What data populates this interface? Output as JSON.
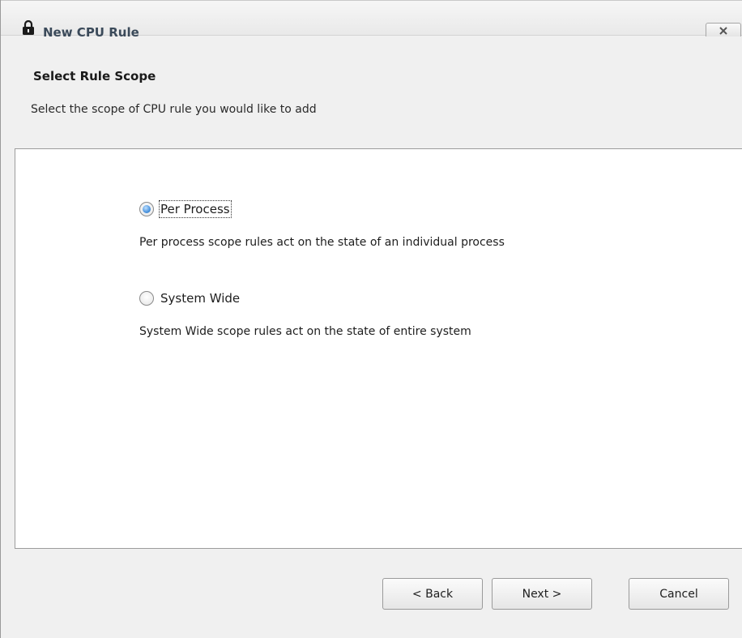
{
  "window": {
    "title": "New CPU Rule",
    "icon": "lock-icon",
    "close_symbol": "✕"
  },
  "header": {
    "title": "Select Rule Scope",
    "subtitle": "Select the scope of CPU rule you would like to add"
  },
  "options": [
    {
      "label": "Per Process",
      "description": "Per process scope rules act on the state of an individual process",
      "selected": true
    },
    {
      "label": "System Wide",
      "description": "System Wide scope rules act on the state of entire system",
      "selected": false
    }
  ],
  "buttons": {
    "back": "< Back",
    "next": "Next >",
    "cancel": "Cancel"
  },
  "colors": {
    "radio_selected": "#4c94dd",
    "title_text": "#3b4a5a",
    "panel_background": "#ffffff",
    "window_background": "#f0f0f0"
  }
}
